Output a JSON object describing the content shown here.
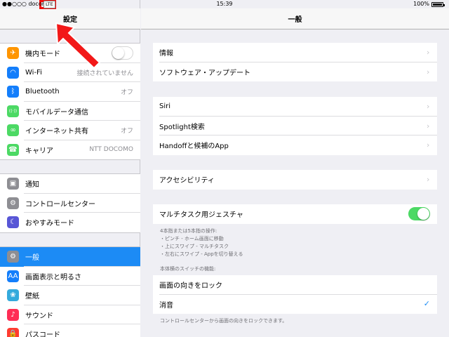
{
  "status_bar": {
    "carrier": "●●○○○ docomo",
    "network": "LTE",
    "time": "15:39",
    "battery": "100%",
    "battery_level": 1.0
  },
  "left_pane": {
    "title": "設定",
    "groups": [
      [
        {
          "label": "機内モード",
          "icon": "airplane-icon",
          "color": "#ff9500",
          "glyph": "✈",
          "control": "toggle",
          "toggle_on": false
        },
        {
          "label": "Wi-Fi",
          "icon": "wifi-icon",
          "color": "#147efb",
          "glyph": "◠",
          "value": "接続されていません"
        },
        {
          "label": "Bluetooth",
          "icon": "bluetooth-icon",
          "color": "#147efb",
          "glyph": "ᛒ",
          "value": "オフ"
        },
        {
          "label": "モバイルデータ通信",
          "icon": "antenna-icon",
          "color": "#4cd964",
          "glyph": "((·))"
        },
        {
          "label": "インターネット共有",
          "icon": "link-icon",
          "color": "#4cd964",
          "glyph": "∞",
          "value": "オフ"
        },
        {
          "label": "キャリア",
          "icon": "phone-icon",
          "color": "#4cd964",
          "glyph": "☎",
          "value": "NTT DOCOMO"
        }
      ],
      [
        {
          "label": "通知",
          "icon": "notifications-icon",
          "color": "#8e8e93",
          "glyph": "▣"
        },
        {
          "label": "コントロールセンター",
          "icon": "control-center-icon",
          "color": "#8e8e93",
          "glyph": "⚙"
        },
        {
          "label": "おやすみモード",
          "icon": "moon-icon",
          "color": "#5856d6",
          "glyph": "☾"
        }
      ],
      [
        {
          "label": "一般",
          "icon": "gear-icon",
          "color": "#8e8e93",
          "glyph": "⚙",
          "selected": true
        },
        {
          "label": "画面表示と明るさ",
          "icon": "display-icon",
          "color": "#147efb",
          "glyph": "AA"
        },
        {
          "label": "壁紙",
          "icon": "wallpaper-icon",
          "color": "#34aadc",
          "glyph": "❀"
        },
        {
          "label": "サウンド",
          "icon": "sound-icon",
          "color": "#ff2d55",
          "glyph": "♪"
        },
        {
          "label": "パスコード",
          "icon": "lock-icon",
          "color": "#ff3b30",
          "glyph": "🔒"
        }
      ]
    ]
  },
  "right_pane": {
    "title": "一般",
    "group1": [
      {
        "label": "情報"
      },
      {
        "label": "ソフトウェア・アップデート"
      }
    ],
    "group2": [
      {
        "label": "Siri"
      },
      {
        "label": "Spotlight検索"
      },
      {
        "label": "Handoffと候補のApp"
      }
    ],
    "group3": [
      {
        "label": "アクセシビリティ"
      }
    ],
    "multitask": {
      "label": "マルチタスク用ジェスチャ",
      "toggle_on": true
    },
    "multitask_footer": [
      "4本指または5本指の操作:",
      "・ピンチ - ホーム画面に移動",
      "・上にスワイプ - マルチタスク",
      "・左右にスワイプ - Appを切り替える"
    ],
    "switch_header": "本体横のスイッチの機能:",
    "switch_options": [
      {
        "label": "画面の向きをロック",
        "checked": false
      },
      {
        "label": "消音",
        "checked": true
      }
    ],
    "switch_footer": "コントロールセンターから画面の向きをロックできます。"
  }
}
